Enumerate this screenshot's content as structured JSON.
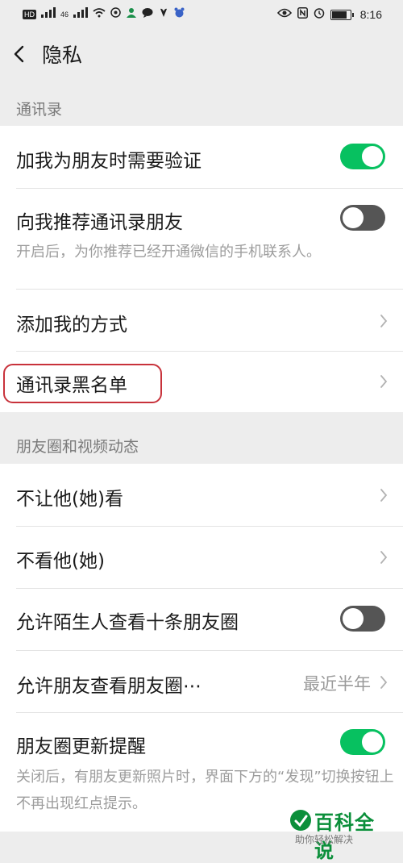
{
  "status_bar": {
    "network_label": "HD",
    "signal_label": "46",
    "time": "8:16"
  },
  "header": {
    "back_icon": "chevron-left-icon",
    "title": "隐私"
  },
  "sections": {
    "contacts": {
      "title": "通讯录",
      "verify_friend": {
        "label": "加我为朋友时需要验证",
        "enabled": true
      },
      "recommend_contacts": {
        "label": "向我推荐通讯录朋友",
        "enabled": false,
        "description": "开启后，为你推荐已经开通微信的手机联系人。"
      },
      "add_methods": {
        "label": "添加我的方式"
      },
      "blacklist": {
        "label": "通讯录黑名单"
      }
    },
    "moments": {
      "title": "朋友圈和视频动态",
      "hide_from": {
        "label": "不让他(她)看"
      },
      "hide_their": {
        "label": "不看他(她)"
      },
      "strangers_ten": {
        "label": "允许陌生人查看十条朋友圈",
        "enabled": false
      },
      "visible_range": {
        "label": "允许朋友查看朋友圈⋯",
        "value": "最近半年"
      },
      "update_reminder": {
        "label": "朋友圈更新提醒",
        "enabled": true,
        "description": "关闭后，有朋友更新照片时，界面下方的“发现”切换按钮上不再出现红点提示。"
      }
    }
  },
  "watermark": {
    "title": "百科全说",
    "subtitle": "助你轻松解决"
  },
  "colors": {
    "toggle_on": "#07c160",
    "toggle_off": "#555555",
    "highlight": "#c8323b",
    "background": "#ededed"
  }
}
